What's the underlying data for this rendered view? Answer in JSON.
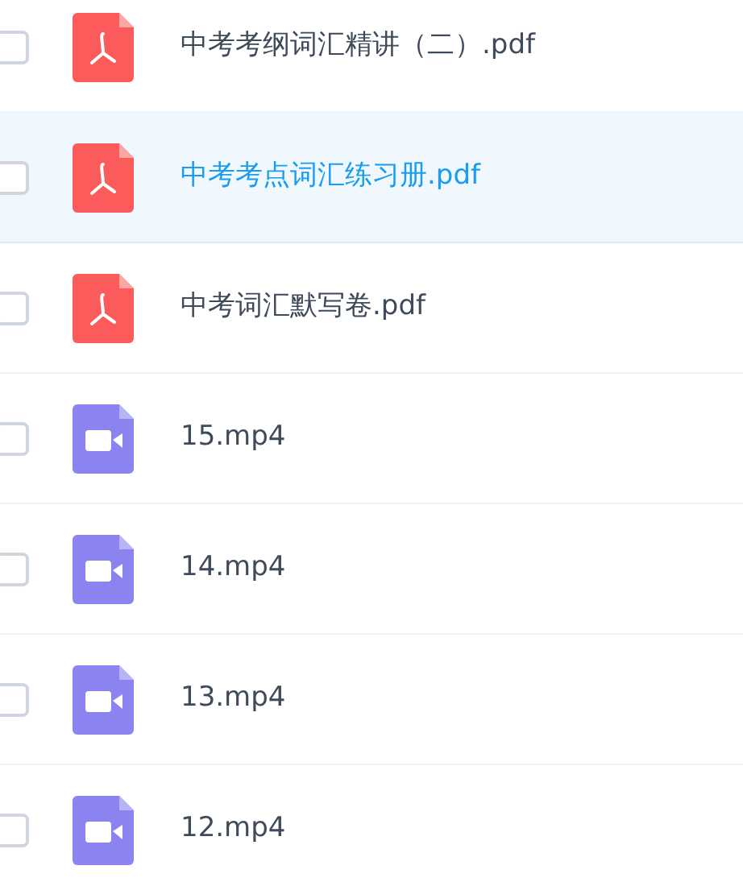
{
  "files": [
    {
      "name": "中考考纲词汇精讲（二）.pdf",
      "kind": "pdf",
      "checked": false,
      "selected": false
    },
    {
      "name": "中考考点词汇练习册.pdf",
      "kind": "pdf",
      "checked": false,
      "selected": true
    },
    {
      "name": "中考词汇默写卷.pdf",
      "kind": "pdf",
      "checked": false,
      "selected": false
    },
    {
      "name": "15.mp4",
      "kind": "video",
      "checked": false,
      "selected": false
    },
    {
      "name": "14.mp4",
      "kind": "video",
      "checked": false,
      "selected": false
    },
    {
      "name": "13.mp4",
      "kind": "video",
      "checked": false,
      "selected": false
    },
    {
      "name": "12.mp4",
      "kind": "video",
      "checked": false,
      "selected": false
    }
  ]
}
